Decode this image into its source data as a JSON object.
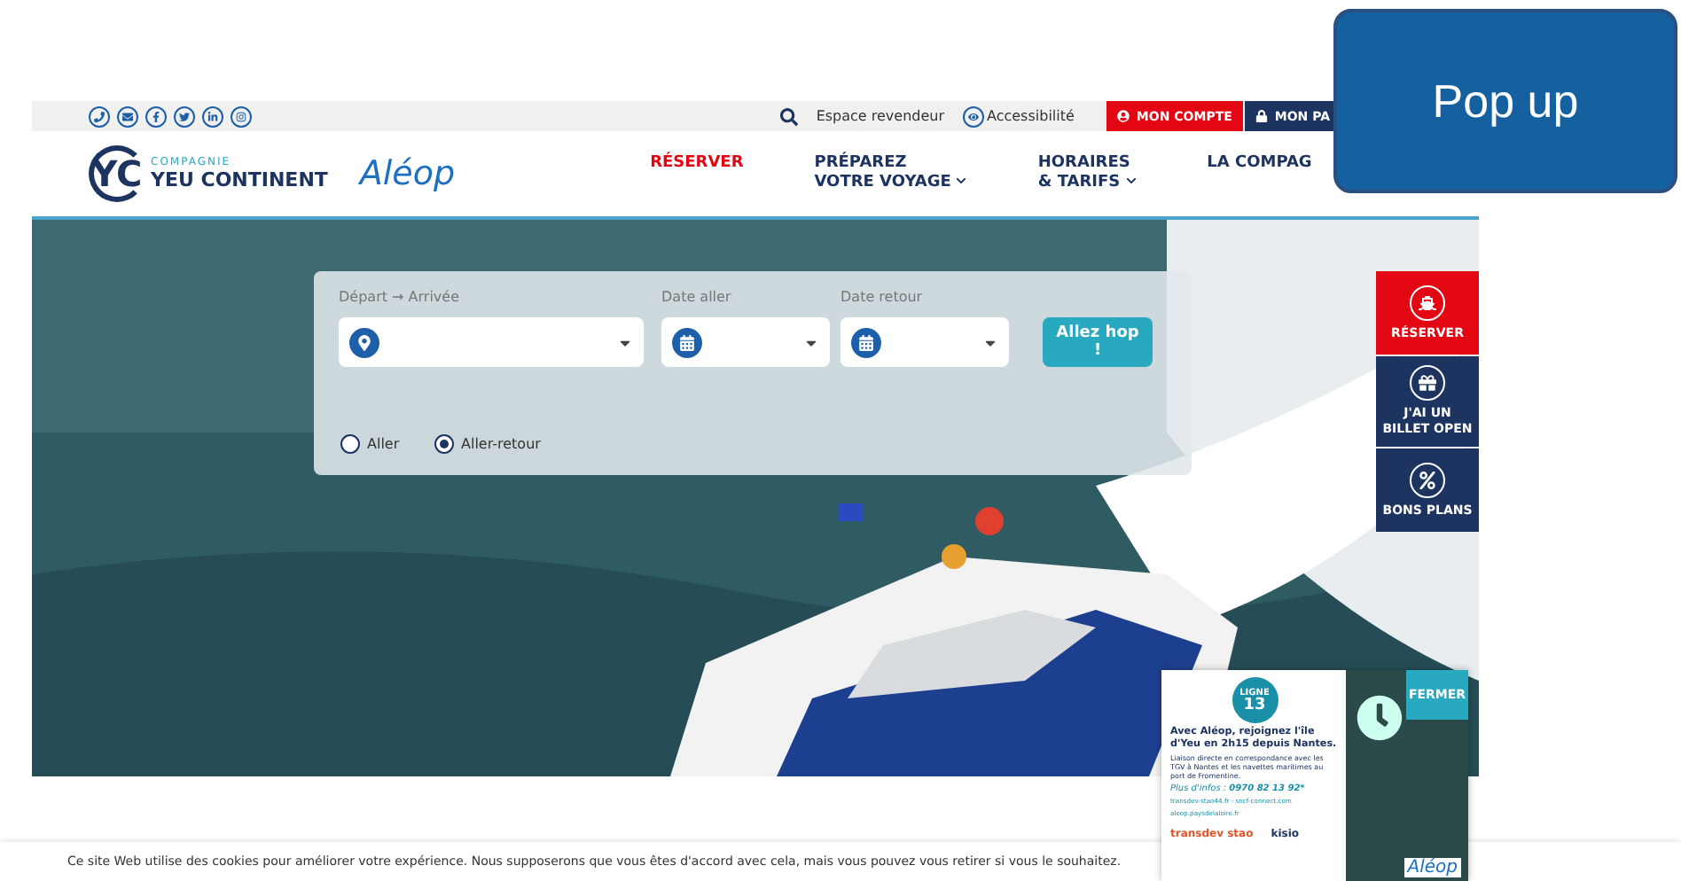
{
  "annotation": {
    "label": "Pop up"
  },
  "top_bar": {
    "links": [
      {
        "kind": "search"
      },
      {
        "kind": "text",
        "label": "Espace revendeur"
      },
      {
        "kind": "icon-text",
        "label": "Accessibilité"
      }
    ],
    "account_buttons": [
      {
        "label": "MON COMPTE",
        "color": "#e30613"
      },
      {
        "label": "MON PA",
        "color": "#1d3461"
      }
    ]
  },
  "header": {
    "brand": {
      "initials": "YC",
      "small": "COMPAGNIE",
      "name": "YEU CONTINENT"
    },
    "partner": "Aléop",
    "nav": [
      {
        "lines": [
          "RÉSERVER"
        ],
        "highlight": true,
        "caret": false
      },
      {
        "lines": [
          "PRÉPAREZ",
          "VOTRE VOYAGE"
        ],
        "highlight": false,
        "caret": true
      },
      {
        "lines": [
          "HORAIRES",
          "& TARIFS"
        ],
        "highlight": false,
        "caret": true
      },
      {
        "lines": [
          "LA COMPAG"
        ],
        "highlight": false,
        "caret": false
      }
    ]
  },
  "search": {
    "fields": [
      {
        "label": "Départ → Arrivée",
        "kind": "place"
      },
      {
        "label": "Date aller",
        "kind": "date"
      },
      {
        "label": "Date retour",
        "kind": "date"
      }
    ],
    "submit": "Allez hop !",
    "trip_types": [
      {
        "label": "Aller",
        "selected": false
      },
      {
        "label": "Aller-retour",
        "selected": true
      }
    ]
  },
  "side_tabs": [
    {
      "label": "RÉSERVER",
      "kind": "ship",
      "color": "#e30613"
    },
    {
      "label": "J'AI UN BILLET OPEN",
      "kind": "gift",
      "color": "#1d3461"
    },
    {
      "label": "BONS PLANS",
      "kind": "discount",
      "color": "#1d3461"
    }
  ],
  "ad": {
    "line_label": "LIGNE",
    "line": "13",
    "headline": "Avec Aléop, rejoignez l'île d'Yeu en 2h15 depuis Nantes.",
    "body": "Liaison directe en correspondance avec les TGV à Nantes et les navettes maritimes au port de Fromentine.",
    "info_label": "Plus d'infos :",
    "phone": "0970 82 13 92*",
    "links": "transdev-stao44.fr - sncf-connect.com",
    "site": "aleop.paysdelaloire.fr",
    "partners": [
      "transdev stao",
      "kisio"
    ],
    "close": "FERMER",
    "brand": "Aléop"
  },
  "cookie_notice": "Ce site Web utilise des cookies pour améliorer votre expérience. Nous supposerons que vous êtes d'accord avec cela, mais vous pouvez vous retirer si vous le souhaitez."
}
